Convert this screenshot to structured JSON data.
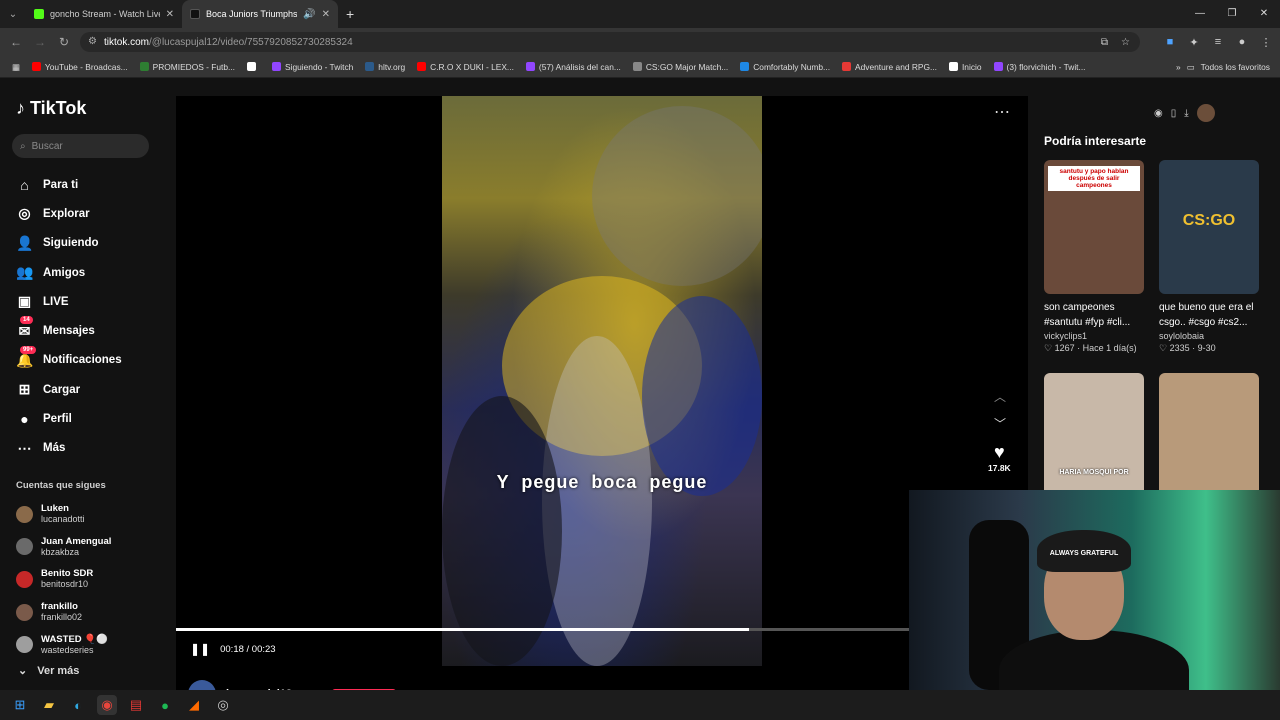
{
  "browser": {
    "tabs": [
      {
        "title": "goncho Stream - Watch Live on",
        "color": "#53fc18",
        "close": "✕"
      },
      {
        "title": "Boca Juniors Triumphs Over",
        "color": "#111111",
        "close": "✕",
        "audio": "🔊"
      }
    ],
    "new_tab": "+",
    "url_host": "tiktok.com",
    "url_path": "/@lucaspujal12/video/7557920852730285324",
    "bookmarks": [
      {
        "label": "YouTube - Broadcas...",
        "color": "#ff0000"
      },
      {
        "label": "PROMIEDOS - Futb...",
        "color": "#2e7d32"
      },
      {
        "label": "",
        "color": "#ffffff"
      },
      {
        "label": "Siguiendo - Twitch",
        "color": "#9146ff"
      },
      {
        "label": "hltv.org",
        "color": "#2b5a8a"
      },
      {
        "label": "C.R.O X DUKI - LEX...",
        "color": "#ff0000"
      },
      {
        "label": "(57) Análisis del can...",
        "color": "#9146ff"
      },
      {
        "label": "CS:GO Major Match...",
        "color": "#888888"
      },
      {
        "label": "Comfortably Numb...",
        "color": "#1e88e5"
      },
      {
        "label": "Adventure and RPG...",
        "color": "#e53935"
      },
      {
        "label": "Inicio",
        "color": "#ffffff"
      },
      {
        "label": "(3) florvichich - Twit...",
        "color": "#9146ff"
      }
    ],
    "bookmarks_more": "»",
    "all_bookmarks": "Todos los favoritos"
  },
  "sidebar": {
    "logo": "TikTok",
    "search_placeholder": "Buscar",
    "nav": [
      {
        "label": "Para ti",
        "icon": "home-icon",
        "glyph": "⌂"
      },
      {
        "label": "Explorar",
        "icon": "compass-icon",
        "glyph": "◎"
      },
      {
        "label": "Siguiendo",
        "icon": "following-icon",
        "glyph": "👤"
      },
      {
        "label": "Amigos",
        "icon": "friends-icon",
        "glyph": "👥"
      },
      {
        "label": "LIVE",
        "icon": "live-icon",
        "glyph": "▣"
      },
      {
        "label": "Mensajes",
        "icon": "messages-icon",
        "glyph": "✉",
        "badge": "14"
      },
      {
        "label": "Notificaciones",
        "icon": "bell-icon",
        "glyph": "🔔",
        "badge": "99+"
      },
      {
        "label": "Cargar",
        "icon": "upload-icon",
        "glyph": "⊞"
      },
      {
        "label": "Perfil",
        "icon": "profile-icon",
        "glyph": "●"
      },
      {
        "label": "Más",
        "icon": "more-icon",
        "glyph": "⋯"
      }
    ],
    "following_header": "Cuentas que sigues",
    "following": [
      {
        "name": "Luken",
        "handle": "lucanadotti",
        "color": "#8a6a4a"
      },
      {
        "name": "Juan Amengual",
        "handle": "kbzakbza",
        "color": "#6a6a6a"
      },
      {
        "name": "Benito SDR",
        "handle": "benitosdr10",
        "color": "#c62828"
      },
      {
        "name": "frankillo",
        "handle": "frankillo02",
        "color": "#7a5a4a"
      },
      {
        "name": "WASTED 🎈⚪",
        "handle": "wastedseries",
        "color": "#9e9e9e"
      }
    ],
    "see_more": "Ver más"
  },
  "player": {
    "caption": "Y pegue boca pegue",
    "time": "00:18 / 00:23",
    "progress_fraction": 0.78,
    "likes": "17.8K",
    "author": "lucaspujal12"
  },
  "right": {
    "header": "Podría interesarte",
    "cards": [
      {
        "title": "son campeones #santutu #fyp #cli...",
        "user": "vickyclips1",
        "meta": "♡ 1267 · Hace 1 día(s)",
        "overlay": "santutu y papo hablan después de salir campeones",
        "bg": "#6a4a3a"
      },
      {
        "title": "que bueno que era el csgo.. #csgo #cs2...",
        "user": "soylolobaia",
        "meta": "♡ 2335 · 9-30",
        "overlay": "CS:GO",
        "bg": "#2a3a4a"
      },
      {
        "title": "",
        "user": "",
        "meta": "",
        "overlay": "HARIA MOSQUI POR",
        "bg": "#c8b8a8"
      },
      {
        "title": "",
        "user": "",
        "meta": "",
        "overlay": "",
        "bg": "#b89a7a"
      }
    ]
  },
  "webcam": {
    "cap_text": "ALWAYS GRATEFUL"
  }
}
